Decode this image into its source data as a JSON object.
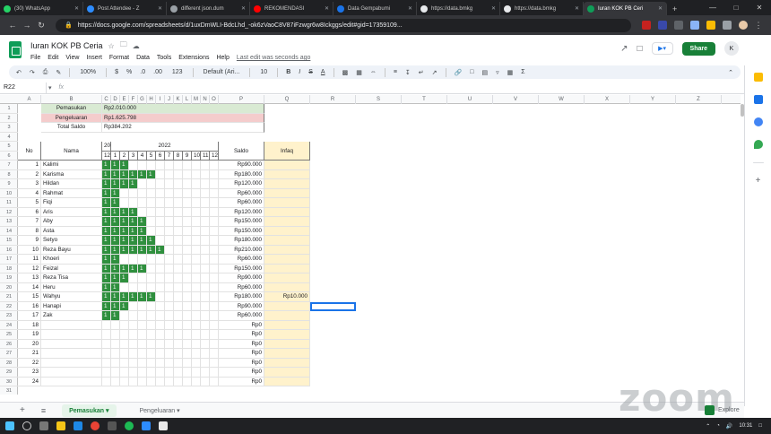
{
  "browser": {
    "tabs": [
      {
        "label": "(30) WhatsApp",
        "color": "#25d366"
      },
      {
        "label": "Post Attendee - Z",
        "color": "#2d8cff"
      },
      {
        "label": "different json.dum",
        "color": "#9aa0a6"
      },
      {
        "label": "REKOMENDASI",
        "color": "#ff0000"
      },
      {
        "label": "Data Gempabumi",
        "color": "#1a73e8"
      },
      {
        "label": "https://data.bmkg",
        "color": "#e8eaed"
      },
      {
        "label": "https://data.bmkg",
        "color": "#e8eaed"
      },
      {
        "label": "Iuran KOK PB Ceri",
        "color": "#0f9d58"
      }
    ],
    "url": "https://docs.google.com/spreadsheets/d/1uxDmWLI-BdcLhd_-ok6zVaoC8V87iFzwgr6w8Ickggs/edit#gid=17359109..."
  },
  "app": {
    "title": "Iuran KOK PB Ceria",
    "menus": [
      "File",
      "Edit",
      "View",
      "Insert",
      "Format",
      "Data",
      "Tools",
      "Extensions",
      "Help"
    ],
    "last_edit": "Last edit was seconds ago",
    "share": "Share",
    "avatar": "K"
  },
  "toolbar": {
    "zoom": "100%",
    "currency": "$",
    "percent": "%",
    "dec0": ".0",
    "dec00": ".00",
    "numfmt": "123",
    "font": "Default (Ari...",
    "size": "10",
    "bold": "B",
    "italic": "I",
    "strike": "S",
    "textcolor": "A"
  },
  "formula": {
    "namebox": "R22",
    "fx": "fx"
  },
  "columns": [
    "A",
    "B",
    "C",
    "D",
    "E",
    "F",
    "G",
    "H",
    "I",
    "J",
    "K",
    "L",
    "M",
    "N",
    "O",
    "P",
    "Q",
    "R",
    "S",
    "T",
    "U",
    "V",
    "W",
    "X",
    "Y",
    "Z"
  ],
  "rows": [
    "1",
    "2",
    "3",
    "4",
    "5",
    "6",
    "7",
    "8",
    "9",
    "10",
    "11",
    "12",
    "13",
    "14",
    "15",
    "16",
    "17",
    "18",
    "19",
    "20",
    "21",
    "22",
    "23",
    "24",
    "25",
    "26",
    "27",
    "28",
    "29",
    "30",
    "31"
  ],
  "summary": [
    {
      "label": "Pemasukan",
      "value": "Rp2.010.000",
      "color": "#d9ead3"
    },
    {
      "label": "Pengeluaran",
      "value": "Rp1.625.798",
      "color": "#f4cccc"
    },
    {
      "label": "Total Saldo",
      "value": "Rp384.202",
      "color": "#ffffff"
    }
  ],
  "table": {
    "no": "No",
    "nama": "Nama",
    "year_prev": "202",
    "year": "2022",
    "saldo": "Saldo",
    "infaq": "Infaq",
    "months": [
      "12",
      "1",
      "2",
      "3",
      "4",
      "5",
      "6",
      "7",
      "8",
      "9",
      "10",
      "11",
      "12"
    ],
    "paid_mark": "1",
    "members": [
      {
        "no": "1",
        "name": "Kalimi",
        "paid": 3,
        "saldo": "Rp90.000",
        "infaq": ""
      },
      {
        "no": "2",
        "name": "Karisma",
        "paid": 6,
        "saldo": "Rp180.000",
        "infaq": ""
      },
      {
        "no": "3",
        "name": "Hildan",
        "paid": 4,
        "saldo": "Rp120.000",
        "infaq": ""
      },
      {
        "no": "4",
        "name": "Rahmat",
        "paid": 2,
        "saldo": "Rp60.000",
        "infaq": ""
      },
      {
        "no": "5",
        "name": "Fiqi",
        "paid": 2,
        "saldo": "Rp60.000",
        "infaq": ""
      },
      {
        "no": "6",
        "name": "Aris",
        "paid": 4,
        "saldo": "Rp120.000",
        "infaq": ""
      },
      {
        "no": "7",
        "name": "Aby",
        "paid": 5,
        "saldo": "Rp150.000",
        "infaq": ""
      },
      {
        "no": "8",
        "name": "Asta",
        "paid": 5,
        "saldo": "Rp150.000",
        "infaq": ""
      },
      {
        "no": "9",
        "name": "Setyo",
        "paid": 6,
        "saldo": "Rp180.000",
        "infaq": ""
      },
      {
        "no": "10",
        "name": "Reza Bayu",
        "paid": 7,
        "saldo": "Rp210.000",
        "infaq": ""
      },
      {
        "no": "11",
        "name": "Khoeri",
        "paid": 2,
        "saldo": "Rp60.000",
        "infaq": ""
      },
      {
        "no": "12",
        "name": "Feizal",
        "paid": 5,
        "saldo": "Rp150.000",
        "infaq": ""
      },
      {
        "no": "13",
        "name": "Reza Tisa",
        "paid": 3,
        "saldo": "Rp90.000",
        "infaq": ""
      },
      {
        "no": "14",
        "name": "Heru",
        "paid": 2,
        "saldo": "Rp60.000",
        "infaq": ""
      },
      {
        "no": "15",
        "name": "Wahyu",
        "paid": 6,
        "saldo": "Rp180.000",
        "infaq": "Rp10.000"
      },
      {
        "no": "16",
        "name": "Hanapi",
        "paid": 3,
        "saldo": "Rp90.000",
        "infaq": ""
      },
      {
        "no": "17",
        "name": "Zak",
        "paid": 2,
        "saldo": "Rp60.000",
        "infaq": ""
      },
      {
        "no": "18",
        "name": "",
        "paid": 0,
        "saldo": "Rp0",
        "infaq": ""
      },
      {
        "no": "19",
        "name": "",
        "paid": 0,
        "saldo": "Rp0",
        "infaq": ""
      },
      {
        "no": "20",
        "name": "",
        "paid": 0,
        "saldo": "Rp0",
        "infaq": ""
      },
      {
        "no": "21",
        "name": "",
        "paid": 0,
        "saldo": "Rp0",
        "infaq": ""
      },
      {
        "no": "22",
        "name": "",
        "paid": 0,
        "saldo": "Rp0",
        "infaq": ""
      },
      {
        "no": "23",
        "name": "",
        "paid": 0,
        "saldo": "Rp0",
        "infaq": ""
      },
      {
        "no": "24",
        "name": "",
        "paid": 0,
        "saldo": "Rp0",
        "infaq": ""
      }
    ]
  },
  "sheets": [
    "Pemasukan",
    "Pengeluaran"
  ],
  "watermark": "zoom",
  "explore": "Explore",
  "taskbar": {
    "time": "10:31"
  }
}
